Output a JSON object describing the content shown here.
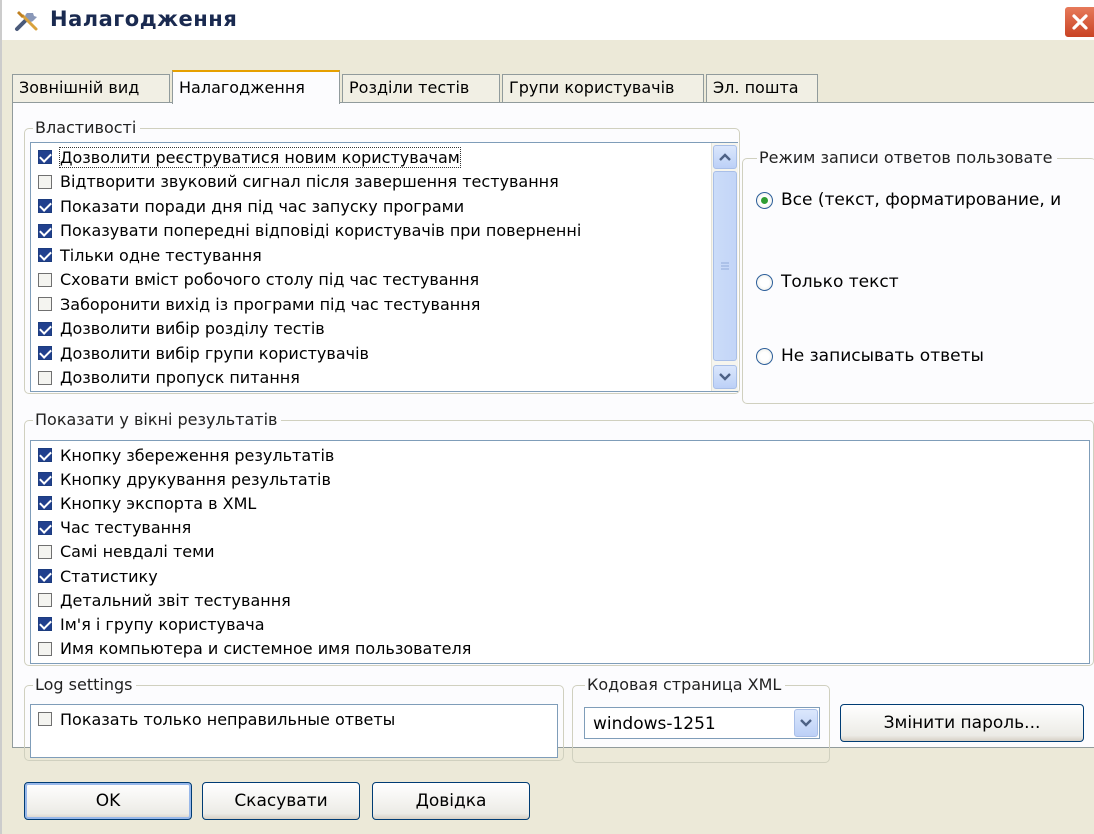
{
  "window": {
    "title": "Налагодження"
  },
  "tabs": [
    "Зовнішній вид",
    "Налагодження",
    "Розділи тестів",
    "Групи користувачів",
    "Эл. пошта"
  ],
  "properties": {
    "legend": "Властивості",
    "items": [
      {
        "label": "Дозволити реєструватися новим користувачам",
        "checked": true
      },
      {
        "label": "Відтворити звуковий сигнал після завершення тестування",
        "checked": false
      },
      {
        "label": "Показати поради дня під час запуску програми",
        "checked": true
      },
      {
        "label": "Показувати попередні відповіді користувачів при поверненні",
        "checked": true
      },
      {
        "label": "Тільки одне тестування",
        "checked": true
      },
      {
        "label": "Сховати вміст робочого столу під час тестування",
        "checked": false
      },
      {
        "label": "Заборонити вихід із програми під час тестування",
        "checked": false
      },
      {
        "label": "Дозволити вибір розділу тестів",
        "checked": true
      },
      {
        "label": "Дозволити вибір групи користувачів",
        "checked": true
      },
      {
        "label": "Дозволити пропуск питання",
        "checked": false
      }
    ]
  },
  "answer_mode": {
    "legend": "Режим записи ответов пользовате",
    "options": [
      {
        "label": "Все (текст, форматирование, и",
        "selected": true
      },
      {
        "label": "Только текст",
        "selected": false
      },
      {
        "label": "Не записывать ответы",
        "selected": false
      }
    ]
  },
  "results": {
    "legend": "Показати у вікні результатів",
    "items": [
      {
        "label": "Кнопку збереження результатів",
        "checked": true
      },
      {
        "label": "Кнопку друкування результатів",
        "checked": true
      },
      {
        "label": "Кнопку экспорта в XML",
        "checked": true
      },
      {
        "label": "Час тестування",
        "checked": true
      },
      {
        "label": "Самі невдалі теми",
        "checked": false
      },
      {
        "label": "Статистику",
        "checked": true
      },
      {
        "label": "Детальний звіт тестування",
        "checked": false
      },
      {
        "label": "Ім'я і групу користувача",
        "checked": true
      },
      {
        "label": "Имя компьютера и системное имя пользователя",
        "checked": false
      }
    ]
  },
  "log_settings": {
    "legend": "Log settings",
    "items": [
      {
        "label": "Показать только неправильные ответы",
        "checked": false
      }
    ]
  },
  "xml_codepage": {
    "legend": "Кодовая страница XML",
    "value": "windows-1251"
  },
  "buttons": {
    "change_password": "Змінити пароль...",
    "ok": "OK",
    "cancel": "Скасувати",
    "help": "Довідка"
  },
  "colors": {
    "accent_tab": "#e6a000",
    "close": "#c94325",
    "check": "#21408e"
  }
}
